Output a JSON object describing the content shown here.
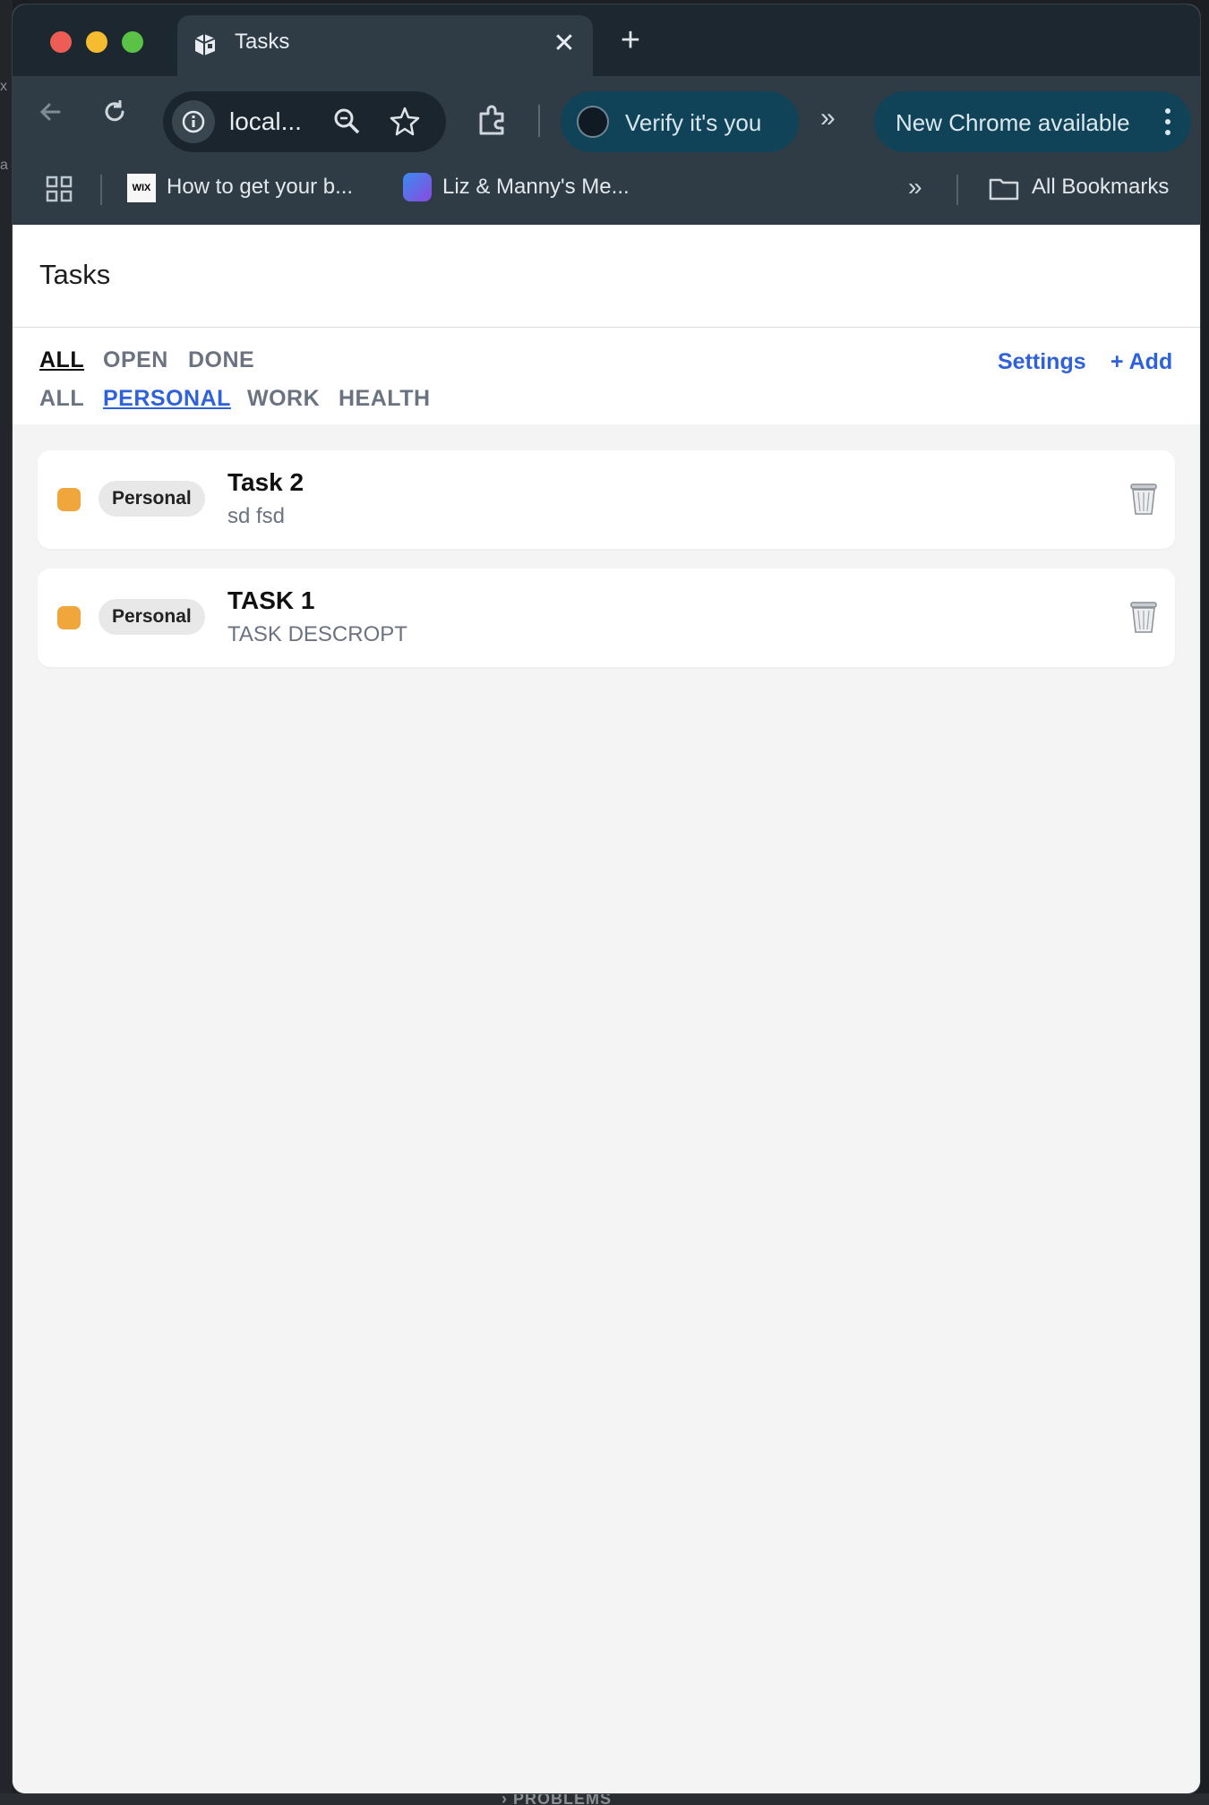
{
  "browser": {
    "tab": {
      "title": "Tasks",
      "close": "✕"
    },
    "new_tab": "+",
    "address": {
      "url": "local..."
    },
    "verify_label": "Verify it's you",
    "overflow": "»",
    "update_label": "New Chrome available",
    "bookmarks": [
      {
        "label": "How to get your b..."
      },
      {
        "label": "Liz & Manny's Me..."
      }
    ],
    "bookmarks_more": "»",
    "all_bookmarks": "All Bookmarks"
  },
  "app": {
    "title": "Tasks",
    "status_filters": [
      "ALL",
      "OPEN",
      "DONE"
    ],
    "active_status": "ALL",
    "category_filters": [
      "ALL",
      "PERSONAL",
      "WORK",
      "HEALTH"
    ],
    "active_category": "PERSONAL",
    "actions": {
      "settings": "Settings",
      "add": "+ Add"
    },
    "tasks": [
      {
        "category": "Personal",
        "title": "Task 2",
        "description": "sd fsd",
        "color": "#f0a63a"
      },
      {
        "category": "Personal",
        "title": "TASK 1",
        "description": "TASK DESCROPT",
        "color": "#f0a63a"
      }
    ]
  },
  "background": {
    "bottom_panel_label": "› PROBLEMS"
  }
}
